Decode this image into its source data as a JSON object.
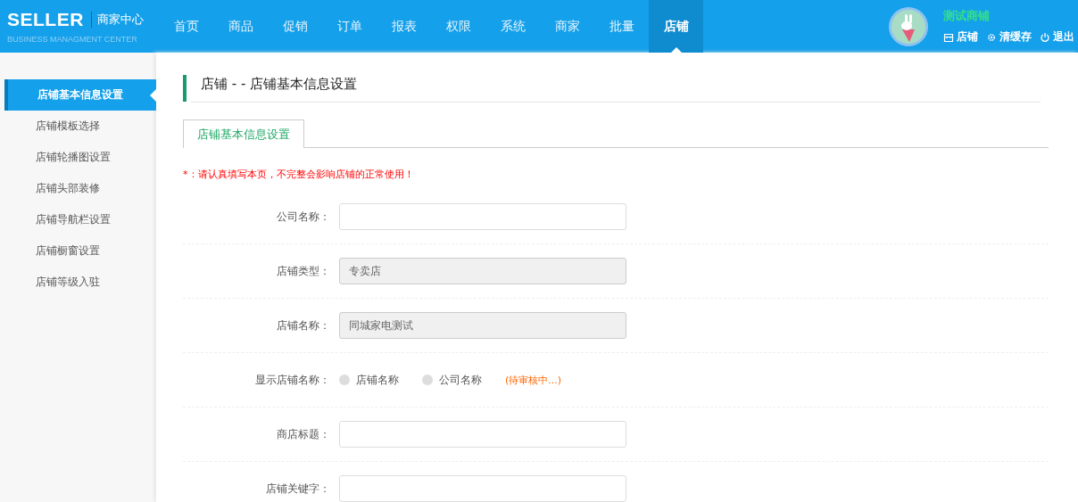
{
  "logo": {
    "title": "SELLER",
    "subtitle": "商家中心",
    "tagline": "BUSINESS MANAGMENT CENTER"
  },
  "nav": [
    {
      "label": "首页",
      "selected": false
    },
    {
      "label": "商品",
      "selected": false
    },
    {
      "label": "促销",
      "selected": false
    },
    {
      "label": "订单",
      "selected": false
    },
    {
      "label": "报表",
      "selected": false
    },
    {
      "label": "权限",
      "selected": false
    },
    {
      "label": "系统",
      "selected": false
    },
    {
      "label": "商家",
      "selected": false
    },
    {
      "label": "批量",
      "selected": false
    },
    {
      "label": "店铺",
      "selected": true
    }
  ],
  "user": {
    "name": "测试商铺",
    "links": [
      {
        "kind": "store",
        "label": "店铺"
      },
      {
        "kind": "settings",
        "label": "清缓存"
      },
      {
        "kind": "power",
        "label": "退出"
      }
    ]
  },
  "sidebar": {
    "items": [
      {
        "label": "店铺基本信息设置",
        "selected": true
      },
      {
        "label": "店铺模板选择",
        "selected": false
      },
      {
        "label": "店铺轮播图设置",
        "selected": false
      },
      {
        "label": "店铺头部装修",
        "selected": false
      },
      {
        "label": "店铺导航栏设置",
        "selected": false
      },
      {
        "label": "店铺橱窗设置",
        "selected": false
      },
      {
        "label": "店铺等级入驻",
        "selected": false
      }
    ]
  },
  "page_title": "店铺 - - 店铺基本信息设置",
  "tabs": [
    {
      "label": "店铺基本信息设置",
      "selected": true
    }
  ],
  "notice": "*：请认真填写本页，不完整会影响店铺的正常使用！",
  "form": [
    {
      "kind": "text",
      "label": "公司名称：",
      "disabled": false
    },
    {
      "kind": "text",
      "label": "店铺类型：",
      "value": "专卖店",
      "disabled": true
    },
    {
      "kind": "text",
      "label": "店铺名称：",
      "value": "同城家电测试",
      "disabled": true
    },
    {
      "kind": "radio",
      "label": "显示店铺名称：",
      "options": [
        {
          "label": "店铺名称",
          "selected": false
        },
        {
          "label": "公司名称",
          "selected": false
        }
      ],
      "status": "(待审核中...)"
    },
    {
      "kind": "text",
      "label": "商店标题：",
      "disabled": false
    },
    {
      "kind": "text",
      "label": "店铺关键字：",
      "disabled": false
    }
  ]
}
